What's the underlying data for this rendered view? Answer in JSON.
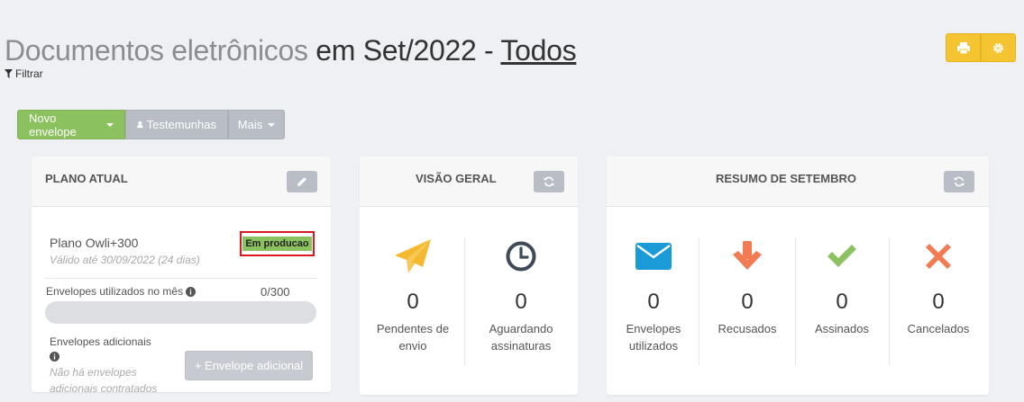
{
  "header": {
    "title_part1": "Documentos eletrônicos",
    "title_part2": "em Set/2022 -",
    "title_link": "Todos",
    "filter_label": "Filtrar"
  },
  "toolbar": {
    "new_envelope": "Novo envelope",
    "witnesses": "Testemunhas",
    "more": "Mais"
  },
  "plan_card": {
    "title": "PLANO ATUAL",
    "plan_name": "Plano Owli+300",
    "valid_until": "Válido até 30/09/2022 (24 dias)",
    "status_badge": "Em producao",
    "usage_label": "Envelopes utilizados no mês",
    "usage_count": "0/300",
    "usage_fraction": 0,
    "additional_label": "Envelopes adicionais",
    "additional_none": "Não há envelopes adicionais contratados",
    "add_button": "+ Envelope adicional"
  },
  "overview_card": {
    "title": "VISÃO GERAL",
    "stats": [
      {
        "value": "0",
        "label": "Pendentes de envio",
        "icon": "paper-plane-icon",
        "color": "#f5b930"
      },
      {
        "value": "0",
        "label": "Aguardando assinaturas",
        "icon": "clock-icon",
        "color": "#3f4a59"
      }
    ]
  },
  "summary_card": {
    "title": "RESUMO DE SETEMBRO",
    "stats": [
      {
        "value": "0",
        "label": "Envelopes utilizados",
        "icon": "envelope-icon",
        "color": "#1a9bd7"
      },
      {
        "value": "0",
        "label": "Recusados",
        "icon": "arrow-down-icon",
        "color": "#f27b53"
      },
      {
        "value": "0",
        "label": "Assinados",
        "icon": "check-icon",
        "color": "#8cc15f"
      },
      {
        "value": "0",
        "label": "Cancelados",
        "icon": "close-icon",
        "color": "#f27b53"
      }
    ]
  }
}
